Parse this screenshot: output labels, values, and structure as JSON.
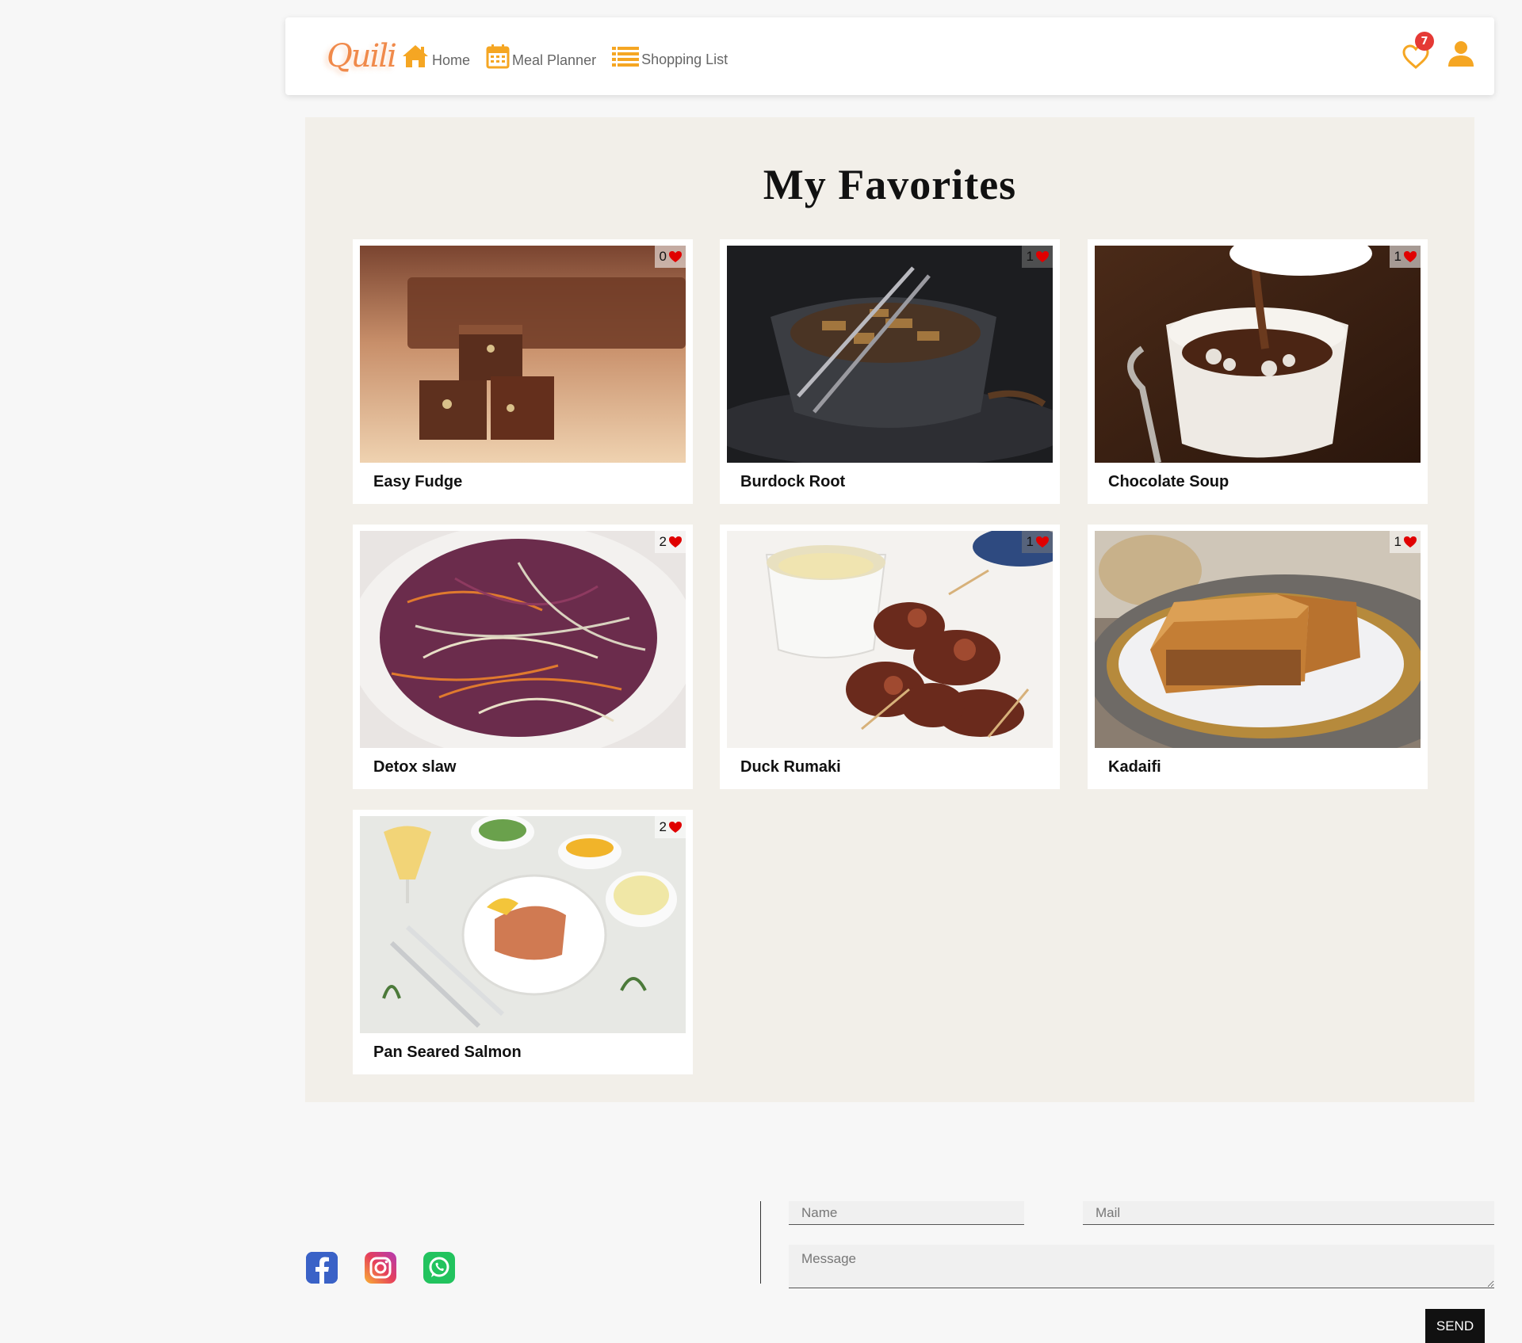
{
  "nav": {
    "logo_text": "Quili",
    "links": [
      {
        "label": "Home",
        "icon": "home-icon"
      },
      {
        "label": "Meal Planner",
        "icon": "calendar-icon"
      },
      {
        "label": "Shopping List",
        "icon": "list-icon"
      }
    ],
    "favorites_count": "7",
    "accent_color": "#f5a623",
    "badge_color": "#e53935"
  },
  "main": {
    "title": "My Favorites",
    "recipes": [
      {
        "name": "Easy Fudge",
        "likes": "0"
      },
      {
        "name": "Burdock Root",
        "likes": "1"
      },
      {
        "name": "Chocolate Soup",
        "likes": "1"
      },
      {
        "name": "Detox slaw",
        "likes": "2"
      },
      {
        "name": "Duck Rumaki",
        "likes": "1"
      },
      {
        "name": "Kadaifi",
        "likes": "1"
      },
      {
        "name": "Pan Seared Salmon",
        "likes": "2"
      }
    ]
  },
  "footer": {
    "social": [
      "facebook-icon",
      "instagram-icon",
      "whatsapp-icon"
    ],
    "form": {
      "name_placeholder": "Name",
      "mail_placeholder": "Mail",
      "message_placeholder": "Message",
      "send_label": "SEND"
    }
  }
}
